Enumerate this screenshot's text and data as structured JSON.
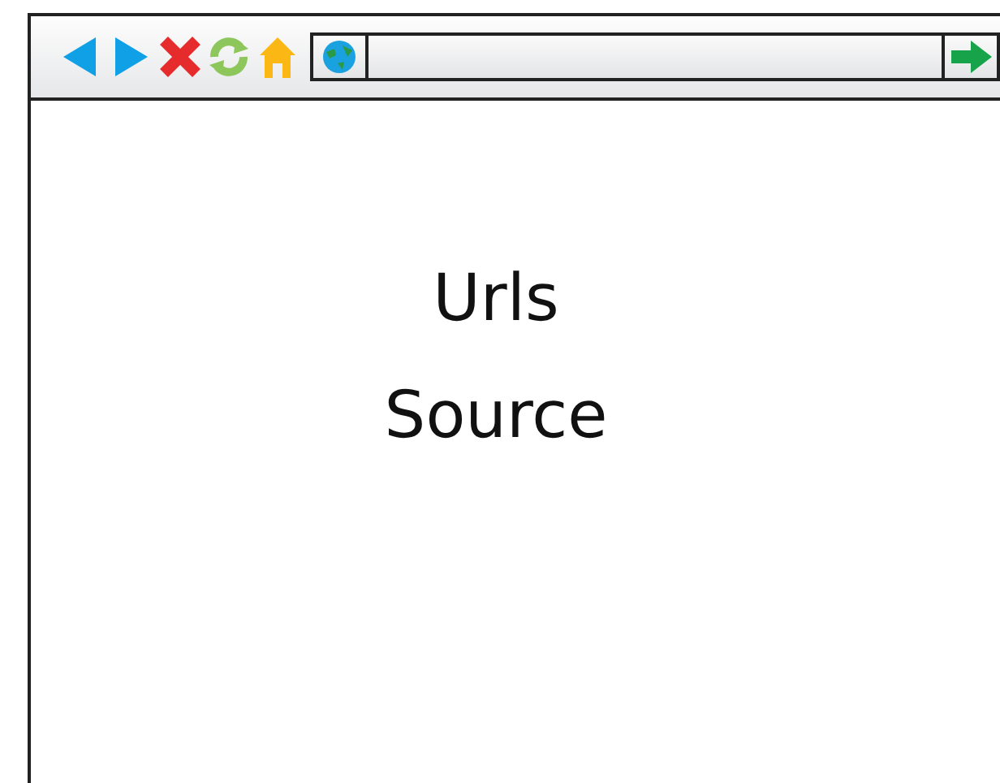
{
  "content": {
    "lines": [
      {
        "text": "Urls"
      },
      {
        "text": "Source"
      }
    ]
  }
}
